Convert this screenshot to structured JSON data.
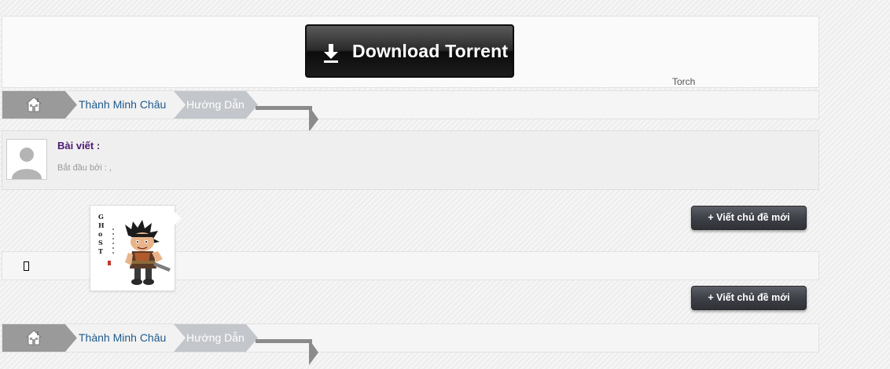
{
  "banner": {
    "download_label": "Download Torrent",
    "torch_label": "Torch"
  },
  "breadcrumb": {
    "home_icon": "home-icon",
    "forum_label": "Thành Minh Châu",
    "current_label": "Hướng Dẫn"
  },
  "thread": {
    "title": "Bài viết :",
    "started_by": "Bắt đầu bởi : ,"
  },
  "actions": {
    "new_thread_label": "+ Viết chủ đề mới"
  },
  "colors": {
    "forum_link": "#1f5a8c",
    "title": "#4b1a72",
    "button_dark": "#3f4148"
  },
  "image_card": {
    "icon": "ghost-character-icon"
  }
}
